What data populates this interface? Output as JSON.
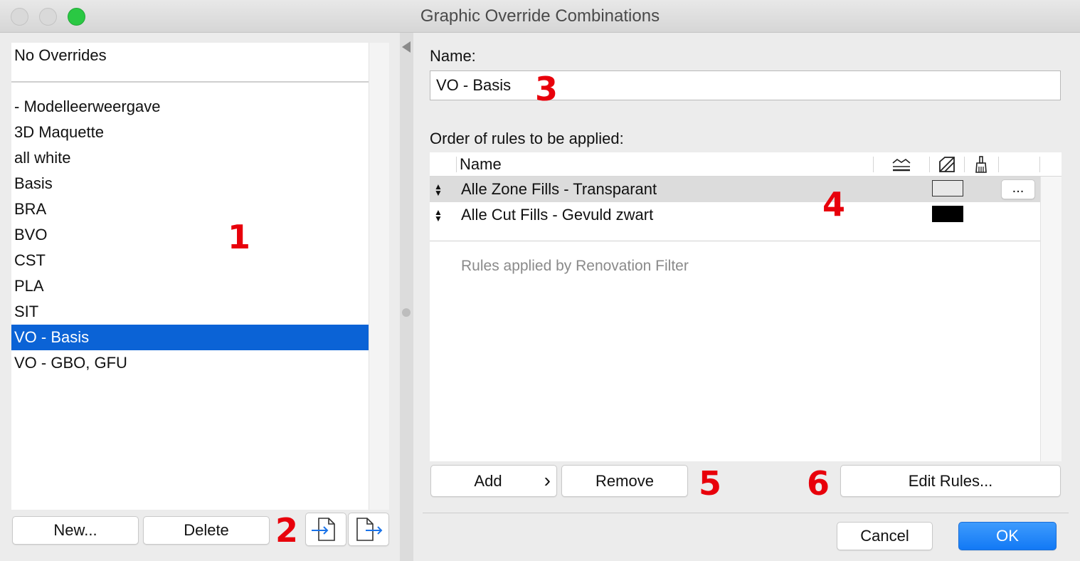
{
  "window": {
    "title": "Graphic Override Combinations",
    "traffic_lights": {
      "close": "#d6d6d6",
      "minimize": "#d6d6d6",
      "zoom": "#2ac843"
    }
  },
  "combinations": {
    "pinned": "No Overrides",
    "items": [
      "- Modelleerweergave",
      "3D Maquette",
      "all white",
      "Basis",
      "BRA",
      "BVO",
      "CST",
      "PLA",
      "SIT",
      "VO - Basis",
      "VO - GBO, GFU"
    ],
    "selected_index": 9,
    "selection_color": "#0b63d6"
  },
  "left_buttons": {
    "new": "New...",
    "delete": "Delete",
    "import_icon": "import-file-icon",
    "export_icon": "export-file-icon"
  },
  "name_field": {
    "label": "Name:",
    "value": "VO - Basis"
  },
  "rules": {
    "label": "Order of rules to be applied:",
    "header": {
      "name": "Name",
      "col_icons": [
        "line-weight-icon",
        "fill-override-icon",
        "surface-brush-icon"
      ]
    },
    "rows": [
      {
        "name": "Alle Zone Fills - Transparant",
        "swatch": "#e8e8e8",
        "more": "...",
        "highlighted": true
      },
      {
        "name": "Alle Cut Fills - Gevuld zwart",
        "swatch": "#000000",
        "highlighted": false
      }
    ],
    "renovation": "Rules applied by Renovation Filter"
  },
  "rule_buttons": {
    "add": "Add",
    "add_chevron": "›",
    "remove": "Remove",
    "edit": "Edit Rules..."
  },
  "dialog_buttons": {
    "cancel": "Cancel",
    "ok": "OK"
  },
  "annotations": [
    "1",
    "2",
    "3",
    "4",
    "5",
    "6"
  ]
}
